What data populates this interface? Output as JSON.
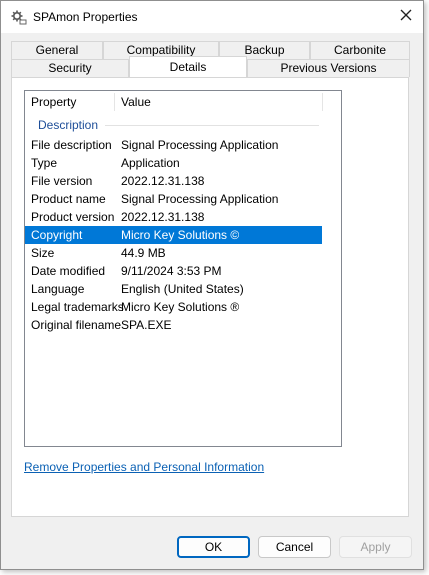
{
  "window": {
    "title": "SPAmon Properties",
    "icon": "gear-app-icon",
    "close_icon": "close-icon"
  },
  "tabs": {
    "row_back": [
      "General",
      "Compatibility",
      "Backup",
      "Carbonite"
    ],
    "row_front": [
      "Security",
      "Details",
      "Previous Versions"
    ],
    "active": "Details"
  },
  "details": {
    "columns": {
      "property": "Property",
      "value": "Value"
    },
    "group": "Description",
    "rows": [
      {
        "property": "File description",
        "value": "Signal Processing Application"
      },
      {
        "property": "Type",
        "value": "Application"
      },
      {
        "property": "File version",
        "value": "2022.12.31.138"
      },
      {
        "property": "Product name",
        "value": "Signal Processing Application"
      },
      {
        "property": "Product version",
        "value": "2022.12.31.138"
      },
      {
        "property": "Copyright",
        "value": "Micro Key Solutions ©"
      },
      {
        "property": "Size",
        "value": "44.9 MB"
      },
      {
        "property": "Date modified",
        "value": "9/11/2024 3:53 PM"
      },
      {
        "property": "Language",
        "value": "English (United States)"
      },
      {
        "property": "Legal trademarks",
        "value": "Micro Key Solutions ®"
      },
      {
        "property": "Original filename",
        "value": "SPA.EXE"
      }
    ],
    "selected_row": "Copyright",
    "selection_color": "#0078d7"
  },
  "link": {
    "label": "Remove Properties and Personal Information"
  },
  "buttons": {
    "ok": "OK",
    "cancel": "Cancel",
    "apply": "Apply"
  },
  "colors": {
    "accent": "#0067c0",
    "link": "#0b61b4",
    "group_header": "#1e4e98"
  }
}
